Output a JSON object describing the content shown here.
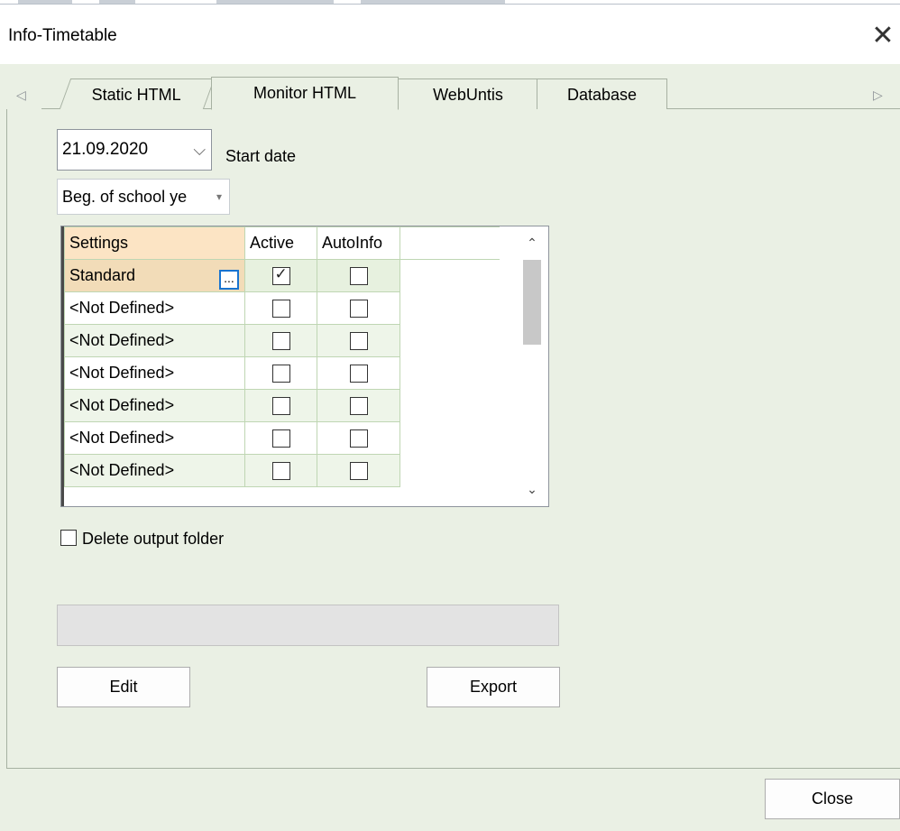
{
  "window": {
    "title": "Info-Timetable",
    "close_glyph": "✕"
  },
  "nav": {
    "left_arrow": "◁",
    "right_arrow": "▷"
  },
  "tabs": [
    {
      "label": "Static HTML",
      "selected": false
    },
    {
      "label": "Monitor HTML",
      "selected": true
    },
    {
      "label": "WebUntis",
      "selected": false
    },
    {
      "label": "Database",
      "selected": false
    }
  ],
  "date_picker": {
    "value": "21.09.2020",
    "chevron": "⌵"
  },
  "start_label": "Start date",
  "period_combo": {
    "value": "Beg. of school ye",
    "arrow": "▾"
  },
  "grid": {
    "headers": [
      "Settings",
      "Active",
      "AutoInfo"
    ],
    "ellipsis": "...",
    "rows": [
      {
        "name": "Standard",
        "active": true,
        "autoinfo": false
      },
      {
        "name": "<Not Defined>",
        "active": false,
        "autoinfo": false
      },
      {
        "name": "<Not Defined>",
        "active": false,
        "autoinfo": false
      },
      {
        "name": "<Not Defined>",
        "active": false,
        "autoinfo": false
      },
      {
        "name": "<Not Defined>",
        "active": false,
        "autoinfo": false
      },
      {
        "name": "<Not Defined>",
        "active": false,
        "autoinfo": false
      },
      {
        "name": "<Not Defined>",
        "active": false,
        "autoinfo": false
      }
    ],
    "scroll_up": "⌃",
    "scroll_down": "⌄"
  },
  "delete_output": {
    "label": "Delete output folder",
    "checked": false
  },
  "buttons": {
    "edit": "Edit",
    "export": "Export",
    "close": "Close"
  },
  "colors": {
    "panel_bg": "#eaf0e4",
    "header_settings": "#fce4c4",
    "selected_row": "#f2dcb8",
    "focus_blue": "#1874d0"
  }
}
